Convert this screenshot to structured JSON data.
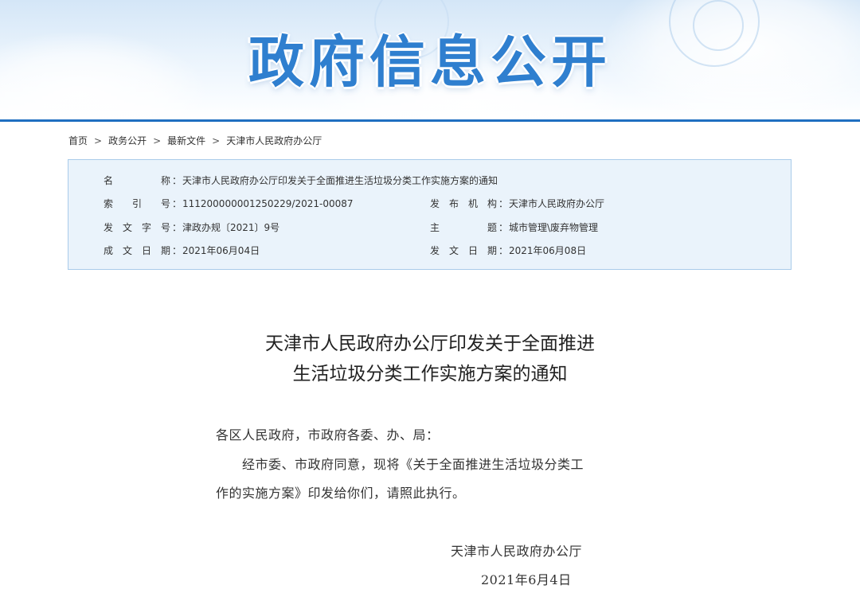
{
  "banner": {
    "title": "政府信息公开"
  },
  "breadcrumb": {
    "items": [
      "首页",
      "政务公开",
      "最新文件",
      "天津市人民政府办公厅"
    ],
    "separator": ">"
  },
  "info": {
    "name_label": [
      "名",
      "称"
    ],
    "name_value": "天津市人民政府办公厅印发关于全面推进生活垃圾分类工作实施方案的通知",
    "index_label": [
      "索",
      "引",
      "号"
    ],
    "index_value": "111200000001250229/2021-00087",
    "issuer_label": [
      "发",
      "布",
      "机",
      "构"
    ],
    "issuer_value": "天津市人民政府办公厅",
    "doc_no_label": [
      "发",
      "文",
      "字",
      "号"
    ],
    "doc_no_value": "津政办规〔2021〕9号",
    "subject_label": [
      "主",
      "题"
    ],
    "subject_value": "城市管理\\废弃物管理",
    "created_label": [
      "成",
      "文",
      "日",
      "期"
    ],
    "created_value": "2021年06月04日",
    "published_label": [
      "发",
      "文",
      "日",
      "期"
    ],
    "published_value": "2021年06月08日",
    "colon": "："
  },
  "document": {
    "title_line1": "天津市人民政府办公厅印发关于全面推进",
    "title_line2": "生活垃圾分类工作实施方案的通知",
    "salutation": "各区人民政府，市政府各委、办、局：",
    "body_line1": "经市委、市政府同意，现将《关于全面推进生活垃圾分类工",
    "body_line2": "作的实施方案》印发给你们，请照此执行。",
    "signature": "天津市人民政府办公厅",
    "date": "2021年6月4日"
  },
  "colors": {
    "banner_title": "#2f7fcf",
    "banner_line": "#1f6fc1",
    "info_bg": "#eaf3fb",
    "info_border": "#a9cbea"
  }
}
